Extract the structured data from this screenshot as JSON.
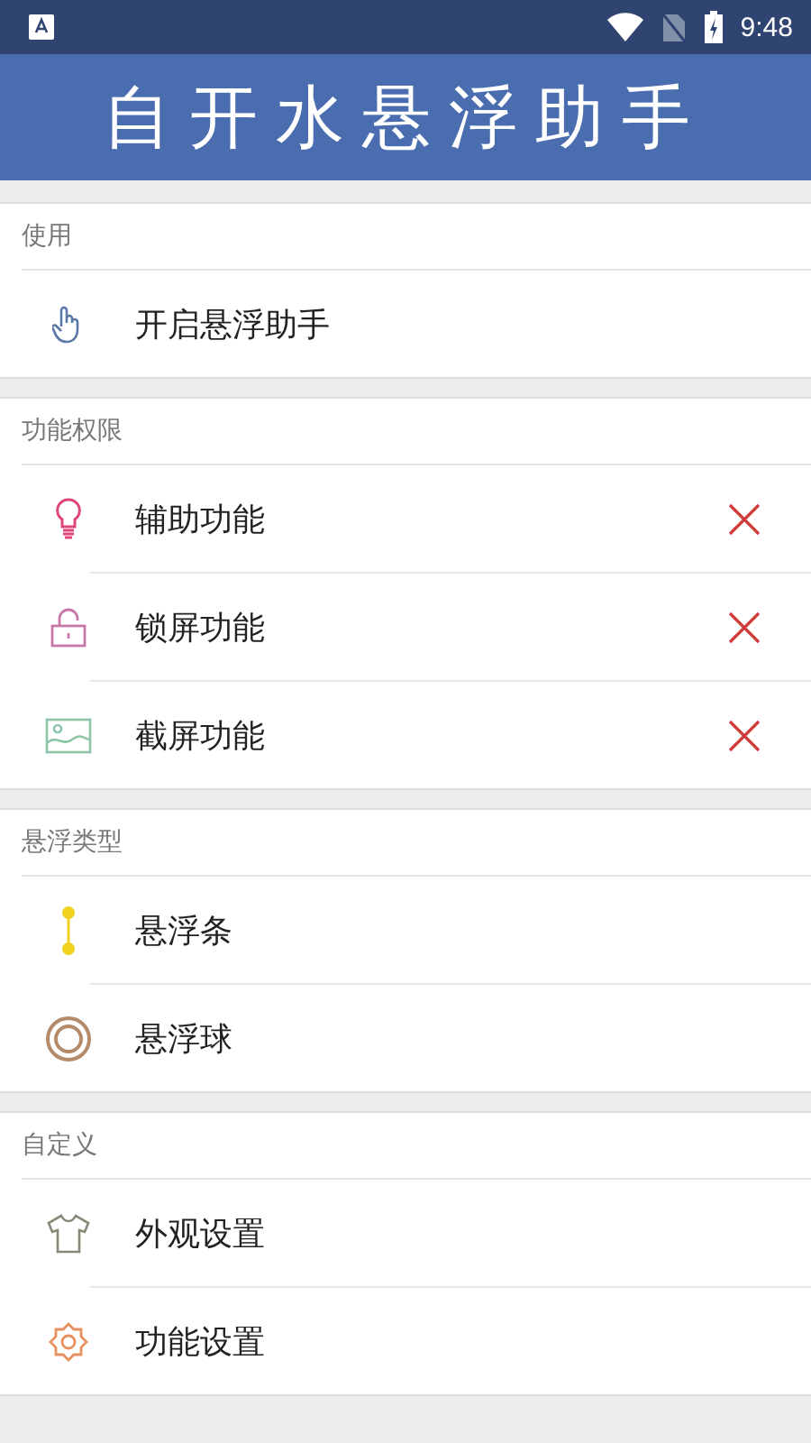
{
  "status_bar": {
    "time": "9:48"
  },
  "header": {
    "title": "自开水悬浮助手"
  },
  "sections": [
    {
      "title": "使用",
      "items": [
        {
          "label": "开启悬浮助手"
        }
      ]
    },
    {
      "title": "功能权限",
      "items": [
        {
          "label": "辅助功能",
          "granted": false
        },
        {
          "label": "锁屏功能",
          "granted": false
        },
        {
          "label": "截屏功能",
          "granted": false
        }
      ]
    },
    {
      "title": "悬浮类型",
      "items": [
        {
          "label": "悬浮条"
        },
        {
          "label": "悬浮球"
        }
      ]
    },
    {
      "title": "自定义",
      "items": [
        {
          "label": "外观设置"
        },
        {
          "label": "功能设置"
        }
      ]
    }
  ]
}
